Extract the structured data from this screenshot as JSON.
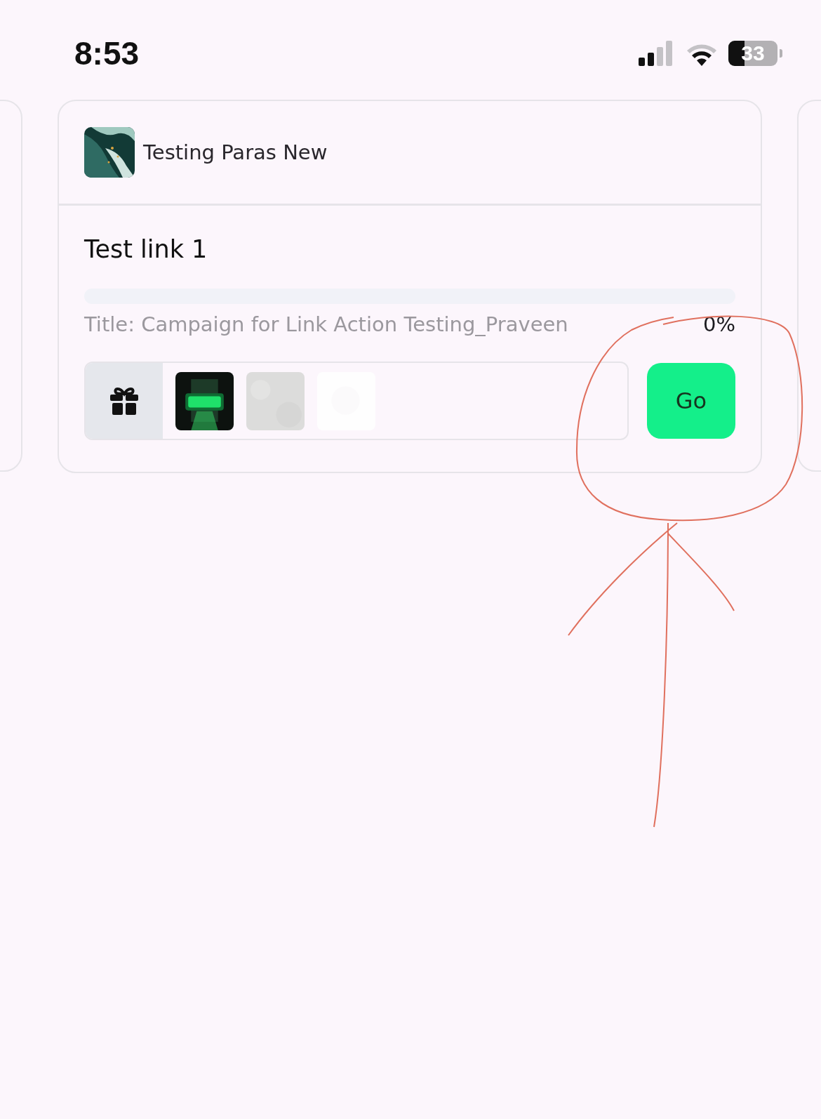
{
  "status_bar": {
    "time": "8:53",
    "battery": "33"
  },
  "card": {
    "project": {
      "name": "Testing Paras New"
    },
    "task": {
      "title": "Test link 1",
      "level": 0,
      "caption": "Title: Campaign for Link Action Testing_Praveen",
      "percent": "0%"
    },
    "action": "Go"
  }
}
